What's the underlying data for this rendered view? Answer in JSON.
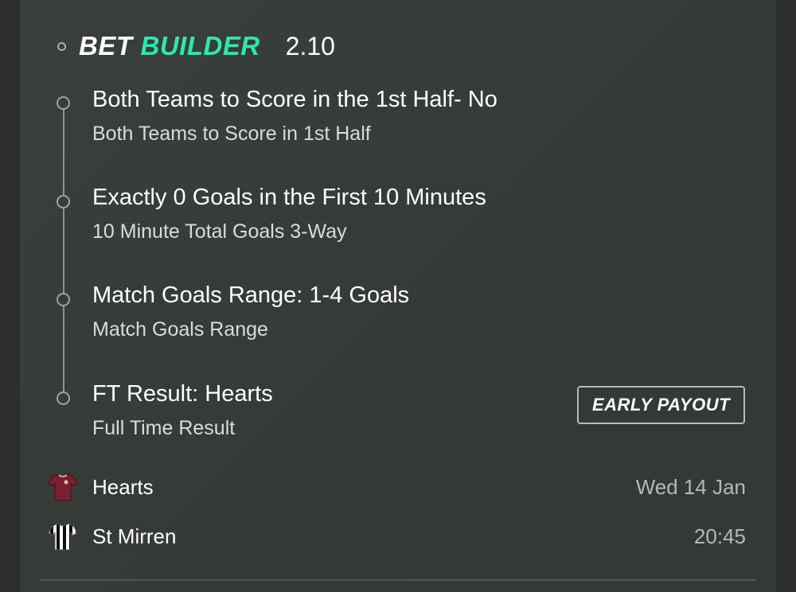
{
  "header": {
    "logo_word1": "BET",
    "logo_word2": "BUILDER",
    "odds": "2.10",
    "accent_color": "#2ee6b0"
  },
  "selections": [
    {
      "title": "Both Teams to Score in the 1st Half- No",
      "market": "Both Teams to Score in 1st Half"
    },
    {
      "title": "Exactly 0 Goals in the First 10 Minutes",
      "market": "10 Minute Total Goals 3-Way"
    },
    {
      "title": "Match Goals Range: 1-4 Goals",
      "market": "Match Goals Range"
    },
    {
      "title": "FT Result: Hearts",
      "market": "Full Time Result"
    }
  ],
  "early_payout_label": "EARLY PAYOUT",
  "teams": [
    {
      "name": "Hearts",
      "meta": "Wed 14 Jan",
      "kit_icon": "maroon-shirt-icon"
    },
    {
      "name": "St Mirren",
      "meta": "20:45",
      "kit_icon": "black-white-striped-shirt-icon"
    }
  ]
}
